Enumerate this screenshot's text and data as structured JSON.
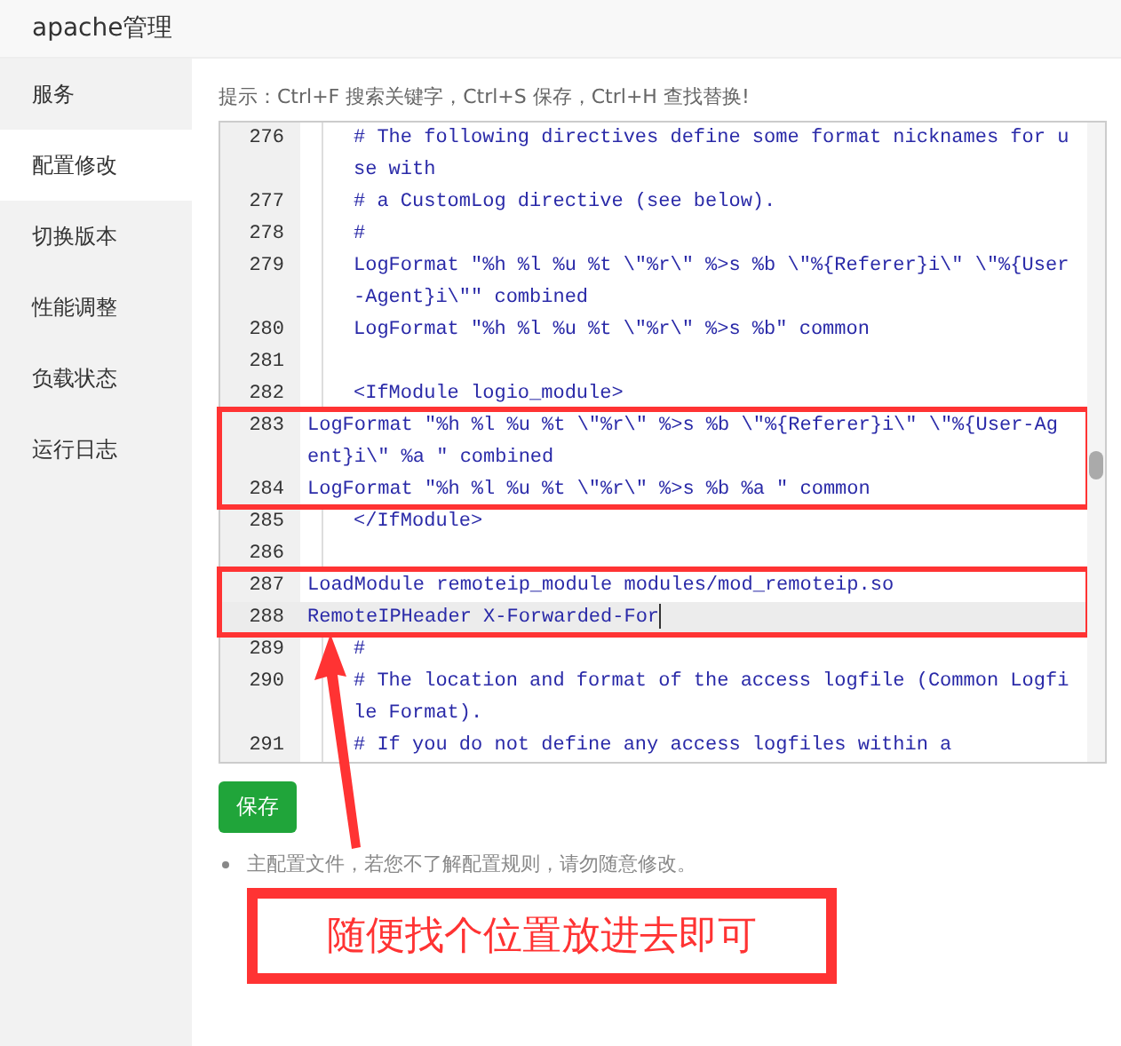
{
  "window": {
    "title": "apache管理"
  },
  "sidebar": {
    "items": [
      {
        "label": "服务",
        "selected": false
      },
      {
        "label": "配置修改",
        "selected": true
      },
      {
        "label": "切换版本",
        "selected": false
      },
      {
        "label": "性能调整",
        "selected": false
      },
      {
        "label": "负载状态",
        "selected": false
      },
      {
        "label": "运行日志",
        "selected": false
      }
    ]
  },
  "hint": "提示：Ctrl+F 搜索关键字，Ctrl+S 保存，Ctrl+H 查找替换!",
  "editor": {
    "lines": [
      {
        "number": "276",
        "text": "# The following directives define some format nicknames for use with",
        "indented": true,
        "active": false,
        "marked": false
      },
      {
        "number": "277",
        "text": "# a CustomLog directive (see below).",
        "indented": true,
        "active": false,
        "marked": false
      },
      {
        "number": "278",
        "text": "#",
        "indented": true,
        "active": false,
        "marked": false
      },
      {
        "number": "279",
        "text": "LogFormat \"%h %l %u %t \\\"%r\\\" %>s %b \\\"%{Referer}i\\\" \\\"%{User-Agent}i\\\"\" combined",
        "indented": true,
        "active": false,
        "marked": false
      },
      {
        "number": "280",
        "text": "LogFormat \"%h %l %u %t \\\"%r\\\" %>s %b\" common",
        "indented": true,
        "active": false,
        "marked": false
      },
      {
        "number": "281",
        "indented": true,
        "active": false,
        "marked": false
      },
      {
        "number": "282",
        "text": "<IfModule logio_module>",
        "indented": true,
        "active": false,
        "marked": false
      },
      {
        "number": "283",
        "text": "LogFormat \"%h %l %u %t \\\"%r\\\" %>s %b \\\"%{Referer}i\\\" \\\"%{User-Agent}i\\\" %a \" combined",
        "indented": false,
        "active": false,
        "marked": true
      },
      {
        "number": "284",
        "text": "LogFormat \"%h %l %u %t \\\"%r\\\" %>s %b %a \" common",
        "indented": false,
        "active": false,
        "marked": true
      },
      {
        "number": "285",
        "text": "</IfModule>",
        "indented": true,
        "active": false,
        "marked": false
      },
      {
        "number": "286",
        "indented": true,
        "active": false,
        "marked": false
      },
      {
        "number": "287",
        "text": "LoadModule remoteip_module modules/mod_remoteip.so",
        "indented": false,
        "active": false,
        "marked": true
      },
      {
        "number": "288",
        "text": "RemoteIPHeader X-Forwarded-For",
        "indented": false,
        "active": true,
        "marked": true
      },
      {
        "number": "289",
        "text": "#",
        "indented": true,
        "active": false,
        "marked": false
      },
      {
        "number": "290",
        "text": "# The location and format of the access logfile (Common Logfile Format).",
        "indented": true,
        "active": false,
        "marked": false
      },
      {
        "number": "291",
        "text": "# If you do not define any access logfiles within a",
        "indented": true,
        "active": false,
        "marked": false
      }
    ]
  },
  "save_button": "保存",
  "note": "主配置文件，若您不了解配置规则，请勿随意修改。",
  "annotation": "随便找个位置放进去即可"
}
